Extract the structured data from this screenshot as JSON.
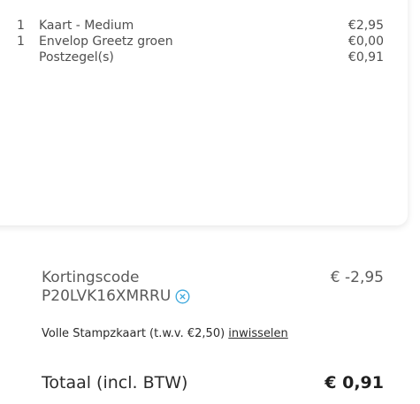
{
  "order_lines": [
    {
      "qty": "1",
      "name": "Kaart - Medium",
      "price": "€2,95"
    },
    {
      "qty": "1",
      "name": "Envelop Greetz groen",
      "price": "€0,00"
    },
    {
      "qty": "",
      "name": "Postzegel(s)",
      "price": "€0,91"
    }
  ],
  "discount": {
    "label": "Kortingscode",
    "code": "P20LVK16XMRRU",
    "amount": "€  -2,95",
    "remove_icon": "close-circle-icon",
    "icon_color": "#3aa7dc"
  },
  "stamp_card": {
    "text": "Volle Stampzkaart (t.w.v. €2,50) ",
    "link_label": "inwisselen"
  },
  "total": {
    "label": "Totaal (incl. BTW)",
    "amount": "€  0,91"
  }
}
